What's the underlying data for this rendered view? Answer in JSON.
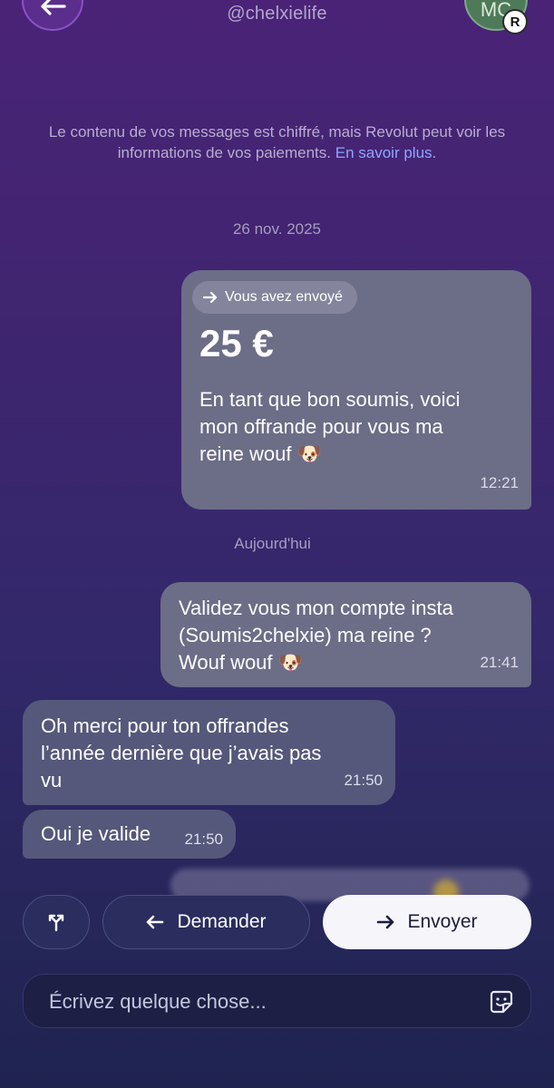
{
  "header": {
    "handle": "@chelxielife",
    "avatar_initials": "MC",
    "avatar_badge": "R"
  },
  "notice": {
    "text": "Le contenu de vos messages est chiffré, mais Revolut peut voir les informations de vos paiements.",
    "link": "En savoir plus"
  },
  "messages": [
    {
      "type": "date",
      "text": "26 nov. 2025"
    },
    {
      "type": "payment",
      "direction": "outgoing",
      "chip_label": "Vous avez envoyé",
      "amount": "25 €",
      "lines": [
        "En tant que bon soumis, voici",
        "mon offrande pour vous ma",
        "reine wouf 🐶"
      ],
      "time": "12:21"
    },
    {
      "type": "date",
      "text": "Aujourd'hui"
    },
    {
      "type": "text",
      "direction": "outgoing",
      "lines": [
        "Validez vous mon compte insta",
        "(Soumis2chelxie) ma reine ?",
        "Wouf wouf 🐶"
      ],
      "time": "21:41"
    },
    {
      "type": "text",
      "direction": "incoming",
      "lines": [
        "Oh merci pour ton offrandes",
        "l’année dernière que j’avais pas",
        "vu"
      ],
      "time": "21:50"
    },
    {
      "type": "text",
      "direction": "incoming",
      "lines": [
        "Oui je valide"
      ],
      "time": "21:50"
    }
  ],
  "actions": {
    "split_icon": "split-icon",
    "request_label": "Demander",
    "send_label": "Envoyer"
  },
  "composer": {
    "placeholder": "Écrivez quelque chose...",
    "sticker_icon": "sticker-icon"
  },
  "colors": {
    "link": "#8ea6ff",
    "bubble": "#6c6d87",
    "send_button": "#f5f5fa"
  }
}
